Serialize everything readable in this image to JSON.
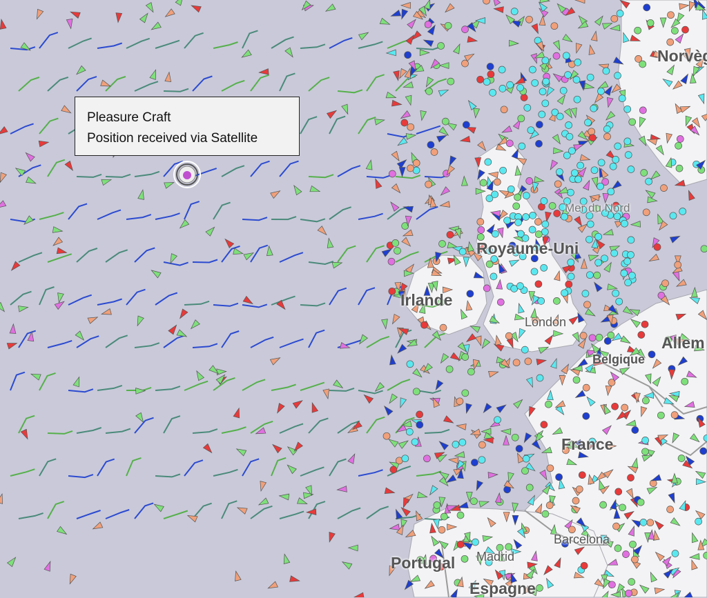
{
  "tooltip": {
    "line1": "Pleasure Craft",
    "line2": "Position received via Satellite"
  },
  "labels": {
    "norway": "Norvèg",
    "uk": "Royaume-Uni",
    "ireland": "Irlande",
    "london": "London",
    "belgium": "Belgique",
    "germany": "Allem",
    "france": "France",
    "madrid": "Madrid",
    "barcelona": "Barcelona",
    "portugal": "Portugal",
    "spain": "Espagne",
    "north_sea": "Mer du Nord"
  },
  "colors": {
    "sea": "#c9c9d9",
    "land": "#f3f3f5",
    "border": "#9a9a9a",
    "cargo": "#7ee07a",
    "tanker": "#e83a3a",
    "pleasure": "#e070e0",
    "fishing": "#f0a07a",
    "passenger": "#1e3fd0",
    "tug": "#5ae8f0",
    "wind_blue": "#2b4ad0",
    "wind_green": "#55b04a",
    "wind_teal": "#4a8a7a"
  },
  "selected_vessel": {
    "type": "Pleasure Craft",
    "icon": "pleasure-craft-icon"
  }
}
